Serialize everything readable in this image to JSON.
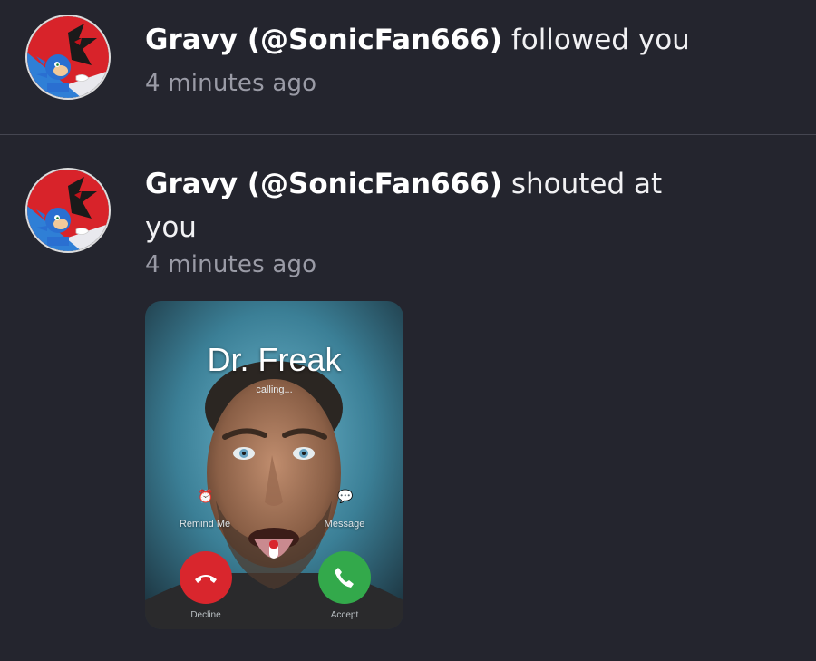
{
  "notifications": [
    {
      "user": "Gravy (@SonicFan666)",
      "action": "followed you",
      "time": "4 minutes ago"
    },
    {
      "user": "Gravy (@SonicFan666)",
      "action": "shouted at you",
      "time": "4 minutes ago",
      "attachment": {
        "caller_name": "Dr. Freak",
        "status": "calling...",
        "remind_label": "Remind Me",
        "message_label": "Message",
        "decline_label": "Decline",
        "accept_label": "Accept"
      }
    }
  ],
  "colors": {
    "background": "#24252e",
    "divider": "#454651",
    "username": "#ffffff",
    "timestamp": "#9a9ba6",
    "decline": "#d9262d",
    "accept": "#33a94b"
  },
  "icons": {
    "avatar": "sonic-shadow-avatar",
    "remind": "alarm-clock-icon",
    "message": "speech-bubble-icon",
    "decline": "phone-hangup-icon",
    "accept": "phone-icon"
  }
}
